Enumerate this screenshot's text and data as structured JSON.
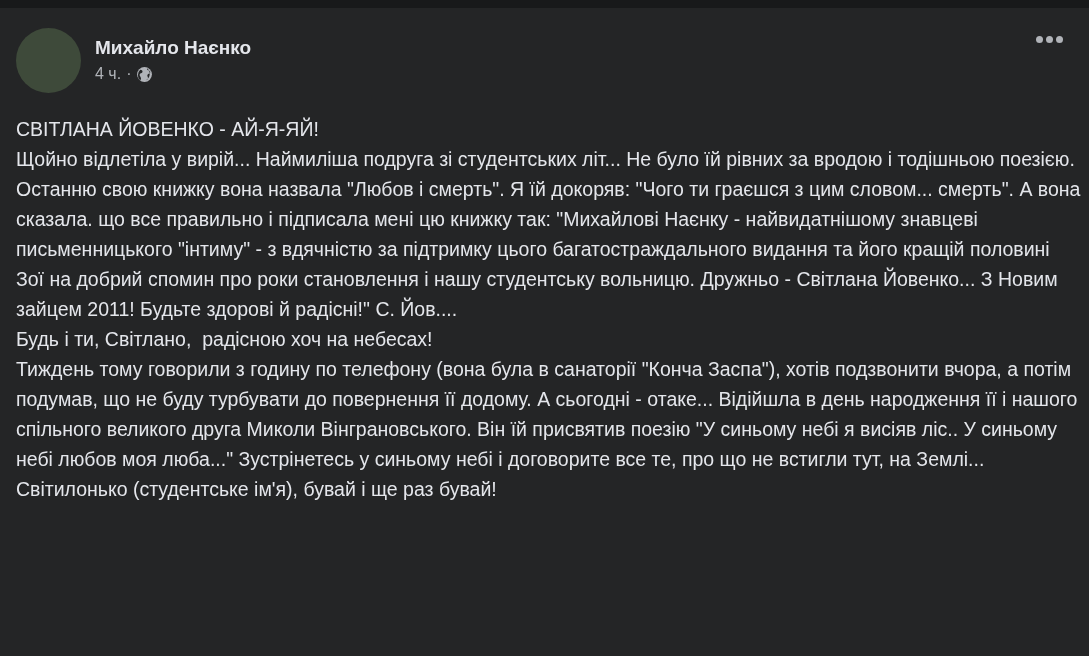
{
  "post": {
    "author": "Михайло Наєнко",
    "time": "4 ч.",
    "separator": "·",
    "paragraphs": [
      "СВІТЛАНА ЙОВЕНКО - АЙ-Я-ЯЙ!",
      "Щойно відлетіла у вирій... Наймиліша подруга зі студентських літ... Не було їй рівних за вродою і тодішньою поезією.  Останню свою книжку вона назвала \"Любов і смерть\". Я їй докоряв: \"Чого ти граєшся з цим словом... смерть\". А вона сказала. що все правильно і підписала мені цю книжку так: \"Михайлові Наєнку - найвидатнішому знавцеві письменницького \"інтиму\" - з вдячністю за підтримку цього багатостраждального видання та його кращій половині Зої на добрий спомин про роки становлення і нашу студентську вольницю. Дружньо - Світлана Йовенко... З Новим зайцем 2011! Будьте здорові й радісні!\" С. Йов....",
      "Будь і ти, Світлано,  радісною хоч на небесах!",
      "Тиждень тому говорили з годину по телефону (вона була в санаторії \"Конча Заспа\"), хотів подзвонити вчора, а потім подумав, що не буду турбувати до повернення її додому. А сьогодні - отаке... Відійшла в день народження її і нашого спільного великого друга Миколи Вінграновського. Він їй присвятив поезію \"У синьому небі я висіяв ліс.. У синьому небі любов моя люба...\" Зустрінетесь у синьому небі і договорите все те, про що не встигли тут, на Землі...",
      "Світилонько (студентське ім'я), бувай і ще раз бувай!"
    ]
  }
}
